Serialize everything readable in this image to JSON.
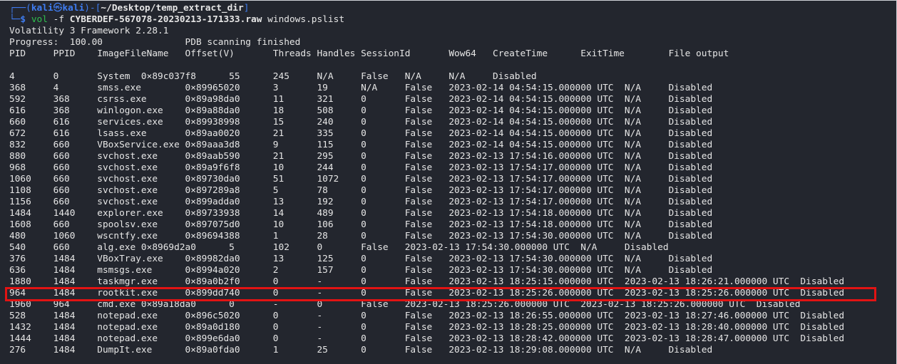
{
  "prompt": {
    "open": "┌──(",
    "user": "kali",
    "skull": "㉿",
    "host": "kali",
    "mid": ")-[",
    "path": "~/Desktop/temp_extract_dir",
    "close": "]",
    "line2_prefix": "└─",
    "dollar": "$ ",
    "cmd": "vol",
    "flag": " -f ",
    "file": "CYBERDEF-567078-20230213-171333.raw",
    "plugin": " windows.pslist"
  },
  "output": {
    "framework": "Volatility 3 Framework 2.28.1",
    "progress": "Progress:  100.00               PDB scanning finished",
    "header": "PID     PPID    ImageFileName   Offset(V)       Threads Handles SessionId       Wow64   CreateTime      ExitTime        File output",
    "blank": "",
    "rows": [
      "4       0       System  0×89c037f8      55      245     N/A     False   N/A     N/A     Disabled",
      "368     4       smss.exe        0×89965020      3       19      N/A     False   2023-02-14 04:54:15.000000 UTC  N/A     Disabled",
      "592     368     csrss.exe       0×89a98da0      11      321     0       False   2023-02-14 04:54:15.000000 UTC  N/A     Disabled",
      "616     368     winlogon.exe    0×89a88da0      18      508     0       False   2023-02-14 04:54:15.000000 UTC  N/A     Disabled",
      "660     616     services.exe    0×89938998      15      240     0       False   2023-02-14 04:54:15.000000 UTC  N/A     Disabled",
      "672     616     lsass.exe       0×89aa0020      21      335     0       False   2023-02-14 04:54:15.000000 UTC  N/A     Disabled",
      "832     660     VBoxService.exe 0×89aaa3d8      9       115     0       False   2023-02-14 04:54:15.000000 UTC  N/A     Disabled",
      "880     660     svchost.exe     0×89aab590      21      295     0       False   2023-02-13 17:54:16.000000 UTC  N/A     Disabled",
      "968     660     svchost.exe     0×89a9f6f8      10      244     0       False   2023-02-13 17:54:17.000000 UTC  N/A     Disabled",
      "1060    660     svchost.exe     0×89730da0      51      1072    0       False   2023-02-13 17:54:17.000000 UTC  N/A     Disabled",
      "1108    660     svchost.exe     0×897289a8      5       78      0       False   2023-02-13 17:54:17.000000 UTC  N/A     Disabled",
      "1156    660     svchost.exe     0×899adda0      13      192     0       False   2023-02-13 17:54:17.000000 UTC  N/A     Disabled",
      "1484    1440    explorer.exe    0×89733938      14      489     0       False   2023-02-13 17:54:18.000000 UTC  N/A     Disabled",
      "1608    660     spoolsv.exe     0×897075d0      10      106     0       False   2023-02-13 17:54:18.000000 UTC  N/A     Disabled",
      "480     1060    wscntfy.exe     0×89694388      1       28      0       False   2023-02-13 17:54:30.000000 UTC  N/A     Disabled",
      "540     660     alg.exe 0×8969d2a0      5       102     0       False   2023-02-13 17:54:30.000000 UTC  N/A     Disabled",
      "376     1484    VBoxTray.exe    0×89982da0      13      125     0       False   2023-02-13 17:54:30.000000 UTC  N/A     Disabled",
      "636     1484    msmsgs.exe      0×8994a020      2       157     0       False   2023-02-13 17:54:30.000000 UTC  N/A     Disabled",
      "1880    1484    taskmgr.exe     0×89a0b2f0      0       -       0       False   2023-02-13 18:25:15.000000 UTC  2023-02-13 18:26:21.000000 UTC  Disabled",
      "964     1484    rootkit.exe     0×899dd740      0       -       0       False   2023-02-13 18:25:26.000000 UTC  2023-02-13 18:25:26.000000 UTC  Disabled",
      "1960    964     cmd.exe 0×89a18da0      0       -       0       False   2023-02-13 18:25:26.000000 UTC  2023-02-13 18:25:26.000000 UTC  Disabled",
      "528     1484    notepad.exe     0×896c5020      0       -       0       False   2023-02-13 18:26:55.000000 UTC  2023-02-13 18:27:46.000000 UTC  Disabled",
      "1432    1484    notepad.exe     0×89a0d180      0       -       0       False   2023-02-13 18:28:25.000000 UTC  2023-02-13 18:28:40.000000 UTC  Disabled",
      "1444    1484    notepad.exe     0×899e6da0      0       -       0       False   2023-02-13 18:28:42.000000 UTC  2023-02-13 18:28:47.000000 UTC  Disabled",
      "276     1484    DumpIt.exe      0×89a0fda0      1       25      0       False   2023-02-13 18:29:08.000000 UTC  N/A     Disabled"
    ]
  },
  "highlight": {
    "row_index": 19,
    "color": "#e21313"
  },
  "colors": {
    "background": "#23262e",
    "prompt": "#3f7df2",
    "command": "#2fbf4e",
    "text": "#e6e6e6"
  }
}
